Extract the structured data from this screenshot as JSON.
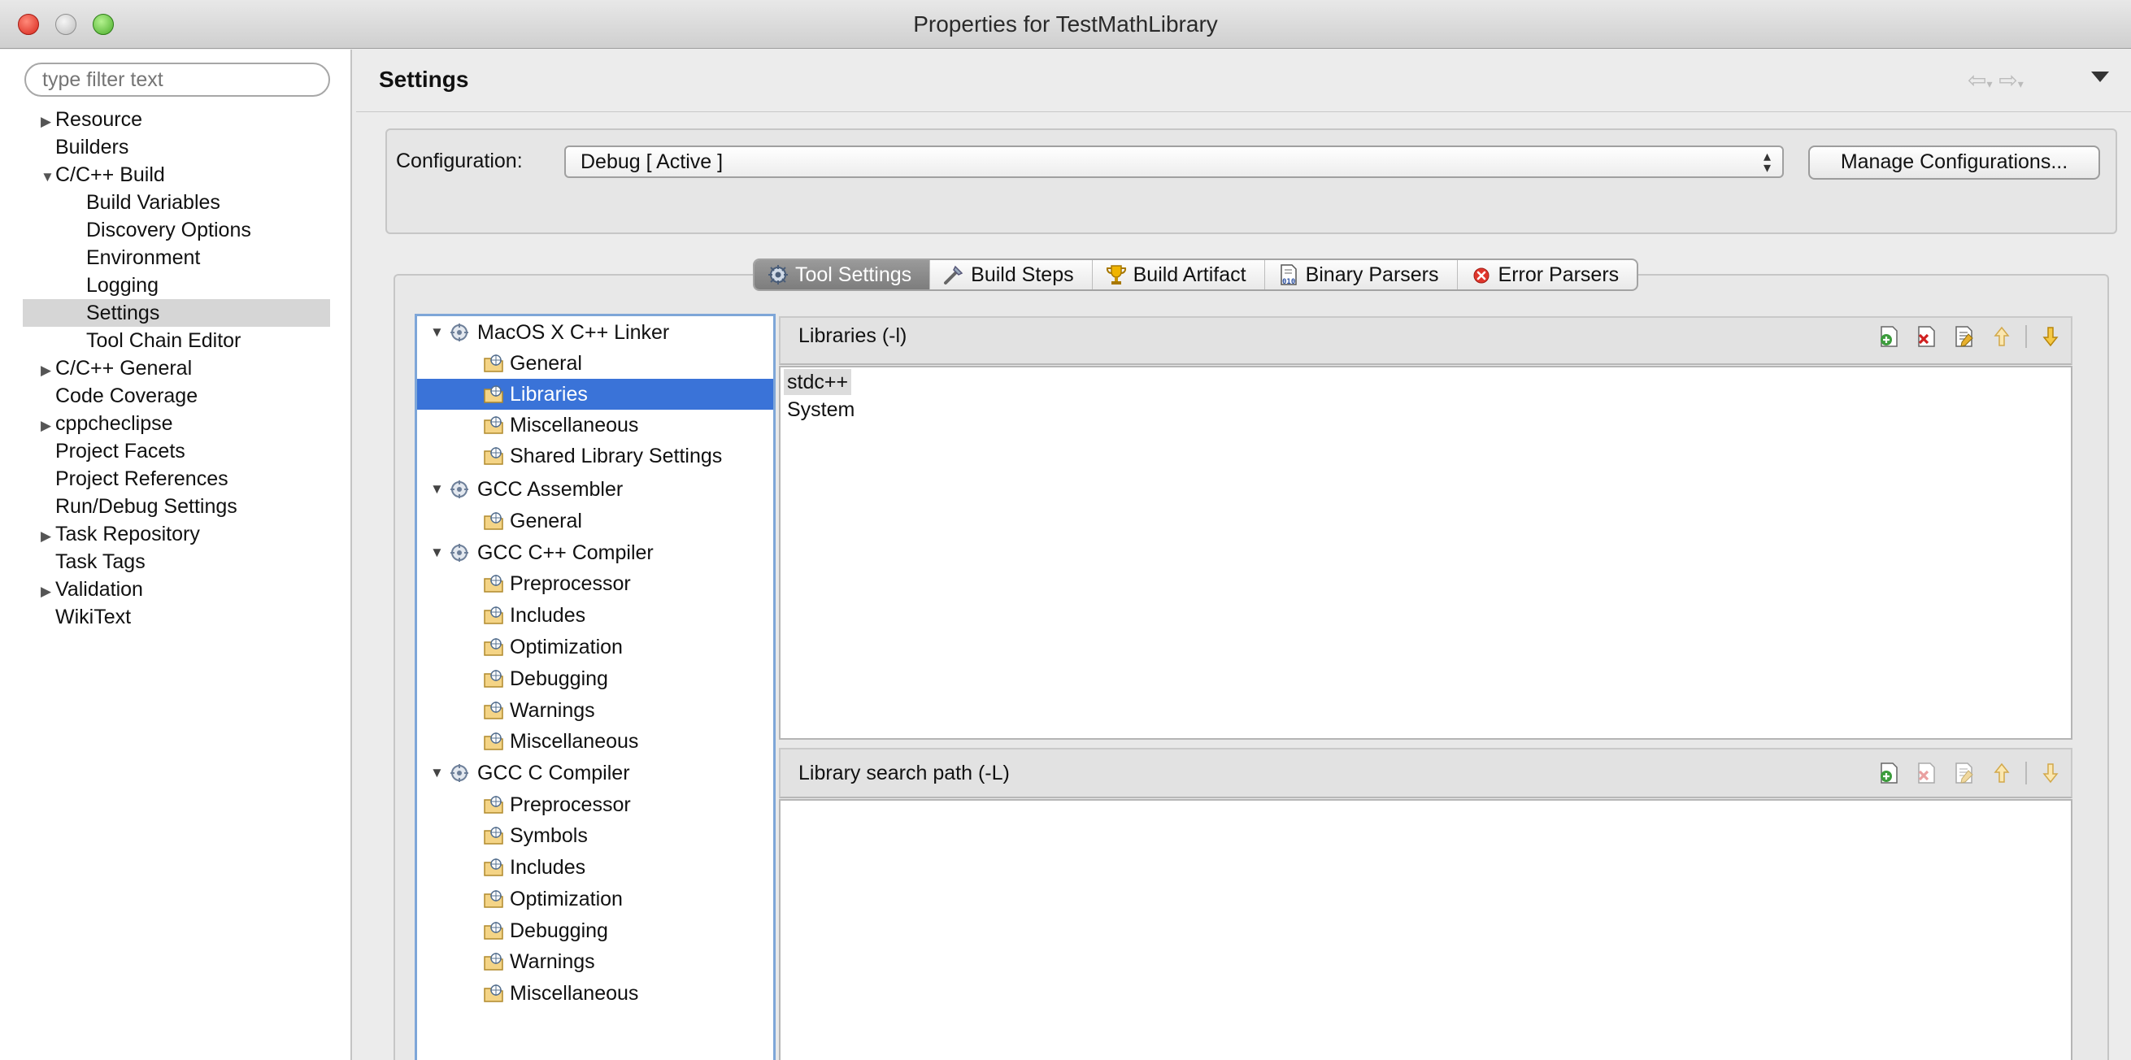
{
  "window": {
    "title": "Properties for TestMathLibrary"
  },
  "filter": {
    "placeholder": "type filter text"
  },
  "nav": {
    "resource": "Resource",
    "builders": "Builders",
    "cpp_build": "C/C++ Build",
    "build_variables": "Build Variables",
    "discovery_options": "Discovery Options",
    "environment": "Environment",
    "logging": "Logging",
    "settings": "Settings",
    "tool_chain_editor": "Tool Chain Editor",
    "cpp_general": "C/C++ General",
    "code_coverage": "Code Coverage",
    "cppcheclipse": "cppcheclipse",
    "project_facets": "Project Facets",
    "project_references": "Project References",
    "run_debug_settings": "Run/Debug Settings",
    "task_repository": "Task Repository",
    "task_tags": "Task Tags",
    "validation": "Validation",
    "wikitext": "WikiText",
    "selected": "Settings"
  },
  "page": {
    "title": "Settings"
  },
  "config": {
    "label": "Configuration:",
    "value": "Debug  [ Active ]",
    "manage_label": "Manage Configurations..."
  },
  "tabs": {
    "tool_settings": "Tool Settings",
    "build_steps": "Build Steps",
    "build_artifact": "Build Artifact",
    "binary_parsers": "Binary Parsers",
    "error_parsers": "Error Parsers",
    "active": "Tool Settings"
  },
  "tree": {
    "macos_linker": "MacOS X C++ Linker",
    "linker_general": "General",
    "linker_libraries": "Libraries",
    "linker_misc": "Miscellaneous",
    "linker_shared": "Shared Library Settings",
    "gcc_assembler": "GCC Assembler",
    "assembler_general": "General",
    "gcc_cpp_compiler": "GCC C++ Compiler",
    "cpp_preprocessor": "Preprocessor",
    "cpp_includes": "Includes",
    "cpp_optimization": "Optimization",
    "cpp_debugging": "Debugging",
    "cpp_warnings": "Warnings",
    "cpp_misc": "Miscellaneous",
    "gcc_c_compiler": "GCC C Compiler",
    "c_preprocessor": "Preprocessor",
    "c_symbols": "Symbols",
    "c_includes": "Includes",
    "c_optimization": "Optimization",
    "c_debugging": "Debugging",
    "c_warnings": "Warnings",
    "c_misc": "Miscellaneous",
    "selected": "Libraries"
  },
  "libraries": {
    "header": "Libraries (-l)",
    "items": [
      "stdc++",
      "System"
    ],
    "selected": "stdc++"
  },
  "search_path": {
    "header": "Library search path (-L)",
    "items": []
  },
  "colors": {
    "selection_blue": "#3a73d8",
    "close_red": "#d8261b",
    "zoom_green": "#4aad2a"
  }
}
